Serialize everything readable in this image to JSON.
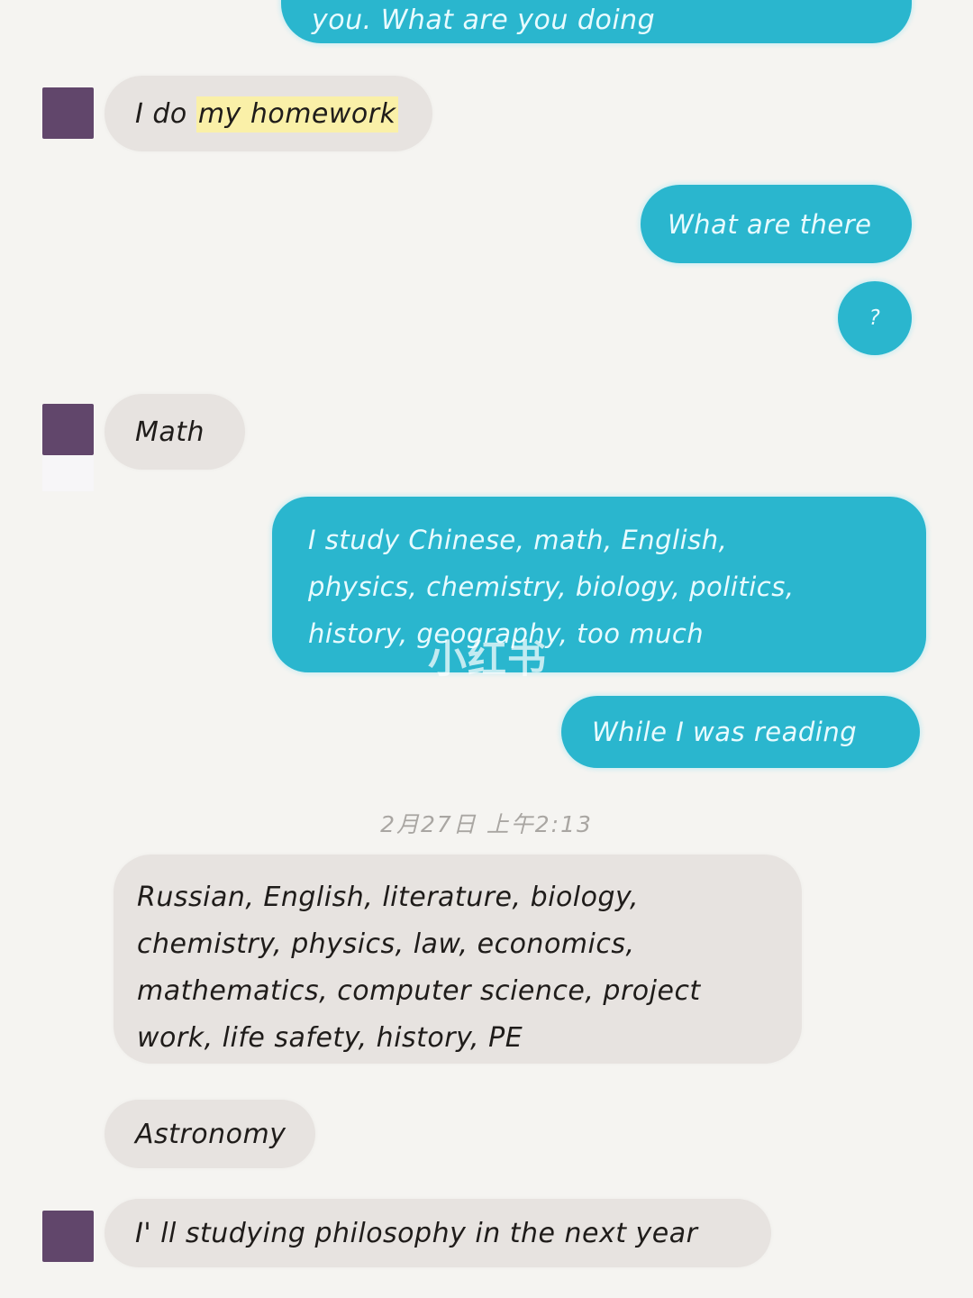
{
  "colors": {
    "background": "#f5f4f1",
    "outgoing_bubble": "#2ab6ce",
    "outgoing_text": "#e8fbff",
    "incoming_bubble": "#e7e3e0",
    "incoming_text": "#1f1c1a",
    "avatar": "#61466b",
    "highlight": "#faf0a8",
    "timestamp_text": "#a9a6a2"
  },
  "watermark": {
    "text": "小红书"
  },
  "timestamp": {
    "text": "2月27日 上午2:13"
  },
  "messages": {
    "top_partial": {
      "text": "you. What are you doing",
      "side": "outgoing"
    },
    "homework": {
      "prefix": "I do ",
      "highlighted": "my homework",
      "side": "incoming"
    },
    "what_are_there": {
      "text": "What are there",
      "side": "outgoing"
    },
    "question": {
      "text": "?",
      "side": "outgoing"
    },
    "math": {
      "text": "Math",
      "side": "incoming"
    },
    "subjects_out": {
      "text": "I study Chinese,  math,  English,\nphysics,  chemistry,  biology,  politics,\nhistory,  geography,  too much",
      "side": "outgoing"
    },
    "while_reading": {
      "text": "While I was reading",
      "side": "outgoing"
    },
    "curriculum": {
      "text": "Russian,  English,  literature,  biology,\nchemistry,  physics,  law,  economics,\nmathematics,  computer science,  project\nwork,  life safety,  history,  PE",
      "side": "incoming"
    },
    "astronomy": {
      "text": "Astronomy",
      "side": "incoming"
    },
    "philosophy": {
      "text": "I' ll studying philosophy in the next year",
      "side": "incoming"
    }
  }
}
